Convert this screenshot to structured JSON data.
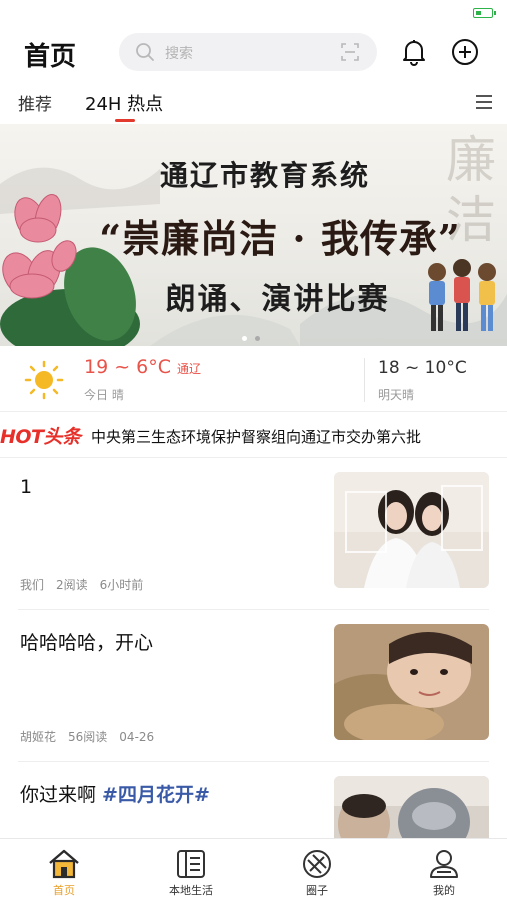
{
  "header": {
    "title": "首页",
    "search_placeholder": "搜索"
  },
  "tabs": [
    {
      "label": "推荐",
      "active": false
    },
    {
      "label": "24H 热点",
      "active": true
    }
  ],
  "banner": {
    "title": "通辽市教育系统",
    "slogan": "“崇廉尚洁 · 我传承”",
    "subtitle": "朗诵、演讲比赛",
    "deco_chars": "廉洁",
    "page_count": 2,
    "current_page": 1
  },
  "weather": {
    "today_temp": "19 ~ 6°C",
    "city": "通辽",
    "today_label": "今日 晴",
    "tomorrow_temp": "18 ~ 10°C",
    "tomorrow_label": "明天晴"
  },
  "hot": {
    "logo": "HOT头条",
    "text": "中央第三生态环境保护督察组向通辽市交办第六批"
  },
  "news": [
    {
      "title": "1",
      "tag": "",
      "author": "我们",
      "reads": "2阅读",
      "time": "6小时前"
    },
    {
      "title": "哈哈哈哈，开心",
      "tag": "",
      "author": "胡姬花",
      "reads": "56阅读",
      "time": "04-26"
    },
    {
      "title": "你过来啊 ",
      "tag": "#四月花开#",
      "author": "",
      "reads": "",
      "time": ""
    }
  ],
  "tabbar": [
    {
      "label": "首页",
      "icon": "home-icon",
      "active": true
    },
    {
      "label": "本地生活",
      "icon": "list-icon",
      "active": false
    },
    {
      "label": "圈子",
      "icon": "circle-icon",
      "active": false
    },
    {
      "label": "我的",
      "icon": "user-icon",
      "active": false
    }
  ],
  "colors": {
    "accent": "#e23b2e",
    "tab_active": "#e8a02a",
    "weather_red": "#e8534a",
    "hashtag": "#3a5aa8"
  }
}
